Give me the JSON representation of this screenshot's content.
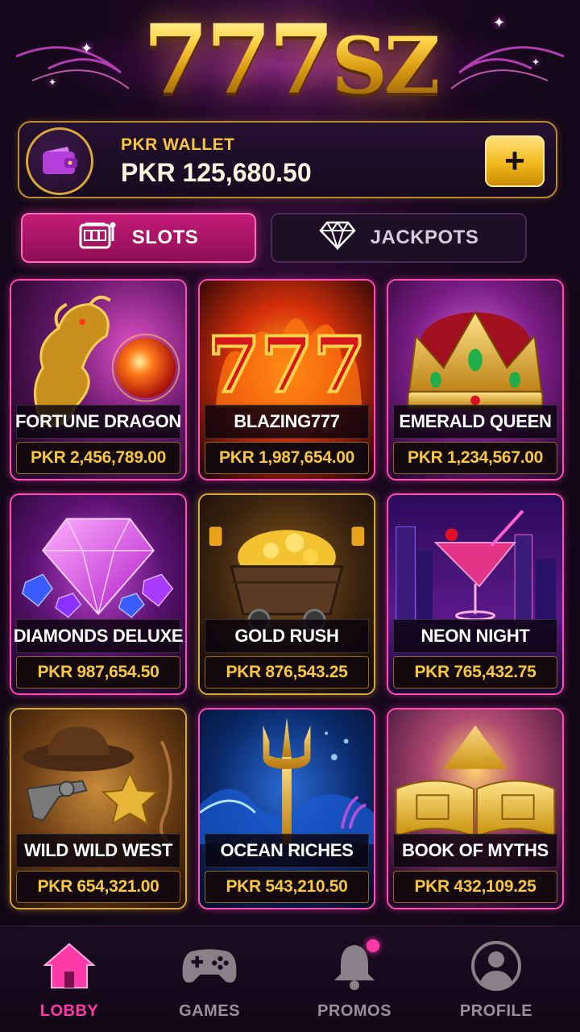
{
  "header": {
    "logo_main": "777",
    "logo_suffix": "SZ"
  },
  "wallet": {
    "label": "PKR WALLET",
    "balance": "PKR 125,680.50",
    "add_label": "+"
  },
  "tabs": [
    {
      "label": "SLOTS",
      "active": true,
      "icon": "slot-machine-icon"
    },
    {
      "label": "JACKPOTS",
      "active": false,
      "icon": "diamond-icon"
    }
  ],
  "games": [
    {
      "name": "FORTUNE DRAGON",
      "jackpot": "PKR 2,456,789.00",
      "art": "golden-dragon",
      "border": "pink"
    },
    {
      "name": "BLAZING777",
      "jackpot": "PKR 1,987,654.00",
      "art": "flaming-777",
      "border": "pink"
    },
    {
      "name": "EMERALD QUEEN",
      "jackpot": "PKR 1,234,567.00",
      "art": "golden-crown",
      "border": "pink"
    },
    {
      "name": "DIAMONDS DELUXE",
      "jackpot": "PKR 987,654.50",
      "art": "pink-diamonds",
      "border": "pink"
    },
    {
      "name": "GOLD RUSH",
      "jackpot": "PKR 876,543.25",
      "art": "gold-mine-cart",
      "border": "gold"
    },
    {
      "name": "NEON NIGHT",
      "jackpot": "PKR 765,432.75",
      "art": "neon-cocktail",
      "border": "pink"
    },
    {
      "name": "WILD WILD WEST",
      "jackpot": "PKR 654,321.00",
      "art": "cowboy-hat",
      "border": "gold"
    },
    {
      "name": "OCEAN RICHES",
      "jackpot": "PKR 543,210.50",
      "art": "golden-trident",
      "border": "pink"
    },
    {
      "name": "BOOK OF MYTHS",
      "jackpot": "PKR 432,109.25",
      "art": "golden-book",
      "border": "pink"
    }
  ],
  "nav": [
    {
      "label": "LOBBY",
      "icon": "home-icon",
      "active": true
    },
    {
      "label": "GAMES",
      "icon": "gamepad-icon",
      "active": false
    },
    {
      "label": "PROMOS",
      "icon": "bell-icon",
      "active": false,
      "badge": true
    },
    {
      "label": "PROFILE",
      "icon": "profile-icon",
      "active": false
    }
  ],
  "colors": {
    "accent_pink": "#ff3aa8",
    "gold": "#f7c744",
    "background": "#0f0714"
  }
}
